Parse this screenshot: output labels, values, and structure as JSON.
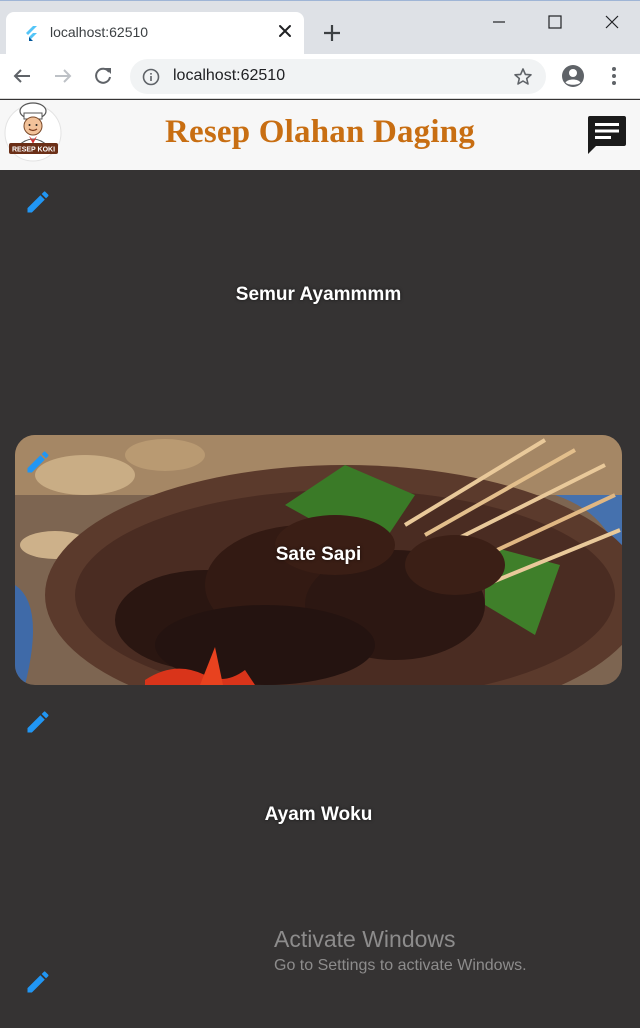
{
  "browser": {
    "tab_title": "localhost:62510",
    "url": "localhost:62510"
  },
  "app": {
    "title": "Resep Olahan Daging",
    "logo_text": "RESEP KOKI",
    "title_color": "#c86e12",
    "background_color": "#353333",
    "edit_icon_color": "#2196f3"
  },
  "recipes": [
    {
      "name": "Semur Ayammmm",
      "has_image": false
    },
    {
      "name": "Sate Sapi",
      "has_image": true
    },
    {
      "name": "Ayam Woku",
      "has_image": false
    },
    {
      "name": "",
      "has_image": false
    }
  ],
  "watermark": {
    "title": "Activate Windows",
    "subtitle": "Go to Settings to activate Windows."
  }
}
